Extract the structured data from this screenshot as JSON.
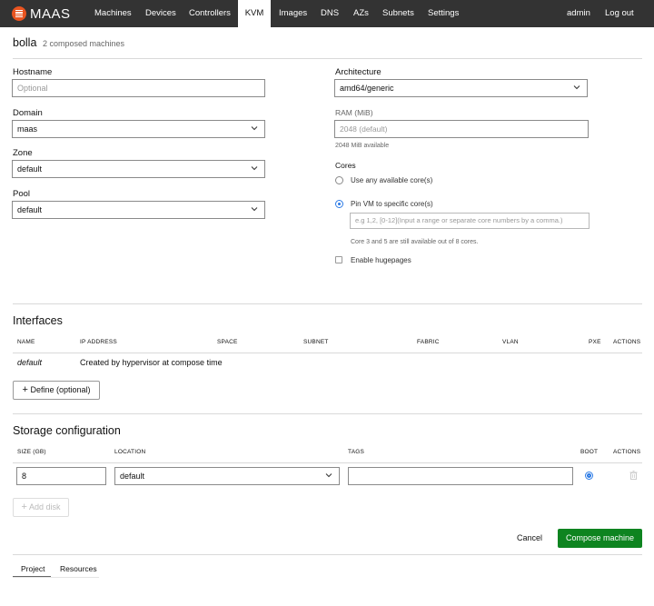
{
  "nav": {
    "brand": "MAAS",
    "items": [
      "Machines",
      "Devices",
      "Controllers",
      "KVM",
      "Images",
      "DNS",
      "AZs",
      "Subnets",
      "Settings"
    ],
    "active": "KVM",
    "user": "admin",
    "logout": "Log out"
  },
  "header": {
    "title": "bolla",
    "subtitle": "2 composed machines"
  },
  "form": {
    "hostname": {
      "label": "Hostname",
      "placeholder": "Optional"
    },
    "domain": {
      "label": "Domain",
      "value": "maas"
    },
    "zone": {
      "label": "Zone",
      "value": "default"
    },
    "pool": {
      "label": "Pool",
      "value": "default"
    },
    "architecture": {
      "label": "Architecture",
      "value": "amd64/generic"
    },
    "ram": {
      "label": "RAM (MiB)",
      "placeholder": "2048 (default)",
      "help": "2048 MiB available"
    },
    "cores": {
      "label": "Cores",
      "option_any": "Use any available core(s)",
      "option_pin": "Pin VM to specific core(s)",
      "pin_placeholder": "e.g 1,2, [0-12](Input a range or separate core numbers by a comma.)",
      "help": "Core 3 and 5 are still available out of 8 cores.",
      "selected": "pin"
    },
    "hugepages": {
      "label": "Enable hugepages",
      "checked": false
    }
  },
  "interfaces": {
    "title": "Interfaces",
    "columns": [
      "NAME",
      "IP ADDRESS",
      "SPACE",
      "SUBNET",
      "FABRIC",
      "VLAN",
      "PXE",
      "ACTIONS"
    ],
    "rows": [
      {
        "name": "default",
        "ip_address": "Created by hypervisor at compose time"
      }
    ],
    "define_button": "Define (optional)"
  },
  "storage": {
    "title": "Storage configuration",
    "columns": [
      "SIZE (GB)",
      "LOCATION",
      "TAGS",
      "BOOT",
      "ACTIONS"
    ],
    "rows": [
      {
        "size": "8",
        "location": "default",
        "tags": "",
        "boot": true
      }
    ],
    "add_disk_button": "Add disk"
  },
  "actions": {
    "cancel": "Cancel",
    "compose": "Compose machine"
  },
  "footer_tabs": [
    "Project",
    "Resources"
  ],
  "colors": {
    "brand": "#e95420",
    "nav_bg": "#333333",
    "primary": "#0e8420",
    "radio": "#2c7be5"
  }
}
